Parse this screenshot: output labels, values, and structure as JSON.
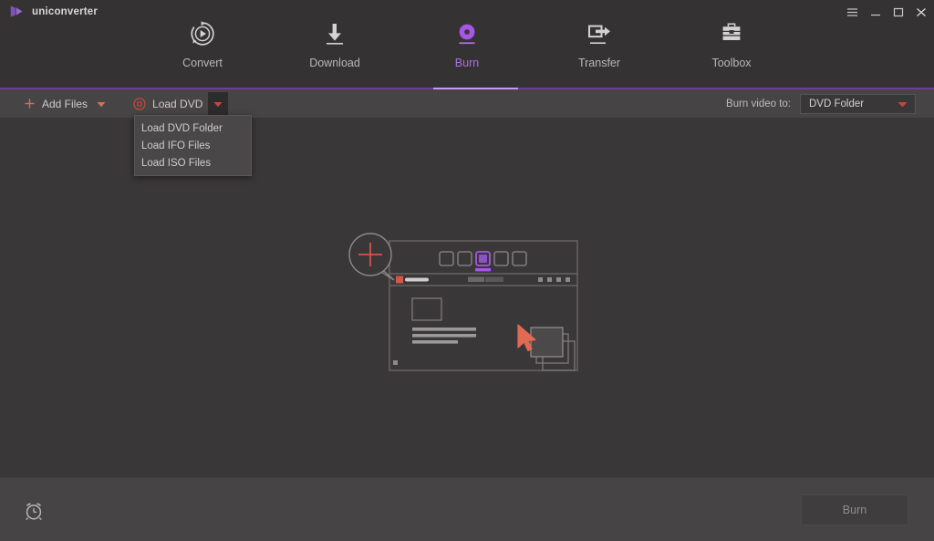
{
  "app": {
    "name": "uniconverter",
    "logo_icon": "play-triangle-logo"
  },
  "window_controls": [
    {
      "name": "menu",
      "icon": "hamburger-icon"
    },
    {
      "name": "minimize",
      "icon": "minimize-icon"
    },
    {
      "name": "maximize",
      "icon": "maximize-icon"
    },
    {
      "name": "close",
      "icon": "close-icon"
    }
  ],
  "nav": {
    "active": "Burn",
    "accent_color": "#a971e0",
    "underline_color": "#c79cf0",
    "tabs": [
      {
        "label": "Convert",
        "icon": "convert-circular-play-icon",
        "active": false
      },
      {
        "label": "Download",
        "icon": "download-arrow-icon",
        "active": false
      },
      {
        "label": "Burn",
        "icon": "burn-disc-icon",
        "active": true
      },
      {
        "label": "Transfer",
        "icon": "transfer-device-arrow-icon",
        "active": false
      },
      {
        "label": "Toolbox",
        "icon": "toolbox-briefcase-icon",
        "active": false
      }
    ]
  },
  "toolbar": {
    "add_files_label": "Add Files",
    "add_files_icon": "plus-icon",
    "add_files_caret_icon": "chevron-down-icon",
    "load_dvd_label": "Load DVD",
    "load_dvd_icon": "disc-icon",
    "load_dvd_caret_icon": "chevron-down-icon",
    "burn_video_to_label": "Burn video to:",
    "burn_target_value": "DVD Folder",
    "burn_target_caret_icon": "chevron-down-icon",
    "accent_color": "#d2705f"
  },
  "dropdown": {
    "open": true,
    "items": [
      {
        "label": "Load DVD Folder"
      },
      {
        "label": "Load IFO Files"
      },
      {
        "label": "Load ISO Files"
      }
    ]
  },
  "placeholder": {
    "icon": "drop-files-illustration",
    "plus_badge_icon": "plus-icon",
    "cursor_icon": "cursor-arrow-icon"
  },
  "footer": {
    "alarm_icon": "alarm-clock-icon",
    "burn_button_label": "Burn",
    "burn_button_enabled": false
  },
  "colors": {
    "window_bg": "#3a3738",
    "header_bg": "#353233",
    "toolbar_bg": "#474445",
    "accent_purple": "#a971e0",
    "accent_salmon": "#d2705f",
    "disc_red": "#c4483c"
  }
}
